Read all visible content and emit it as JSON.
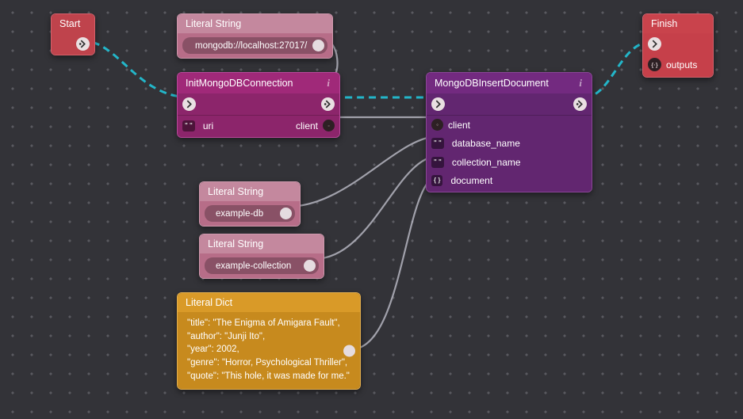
{
  "nodes": {
    "start": {
      "title": "Start"
    },
    "finish": {
      "title": "Finish",
      "outputs_label": "outputs"
    },
    "literal_uri": {
      "title": "Literal String",
      "value": "mongodb://localhost:27017/"
    },
    "literal_db": {
      "title": "Literal String",
      "value": "example-db"
    },
    "literal_coll": {
      "title": "Literal String",
      "value": "example-collection"
    },
    "literal_dict": {
      "title": "Literal Dict",
      "lines": [
        "\"title\": \"The Enigma of Amigara Fault\",",
        "\"author\": \"Junji Ito\",",
        "\"year\": 2002,",
        "\"genre\": \"Horror, Psychological Thriller\",",
        "\"quote\": \"This hole, it was made for me.\""
      ]
    },
    "init": {
      "title": "InitMongoDBConnection",
      "uri_label": "uri",
      "client_label": "client"
    },
    "insert": {
      "title": "MongoDBInsertDocument",
      "ports": {
        "client": "client",
        "database": "database_name",
        "collection": "collection_name",
        "document": "document"
      }
    }
  },
  "colors": {
    "flow": "#23b6c9",
    "data": "#b5b5bf"
  }
}
